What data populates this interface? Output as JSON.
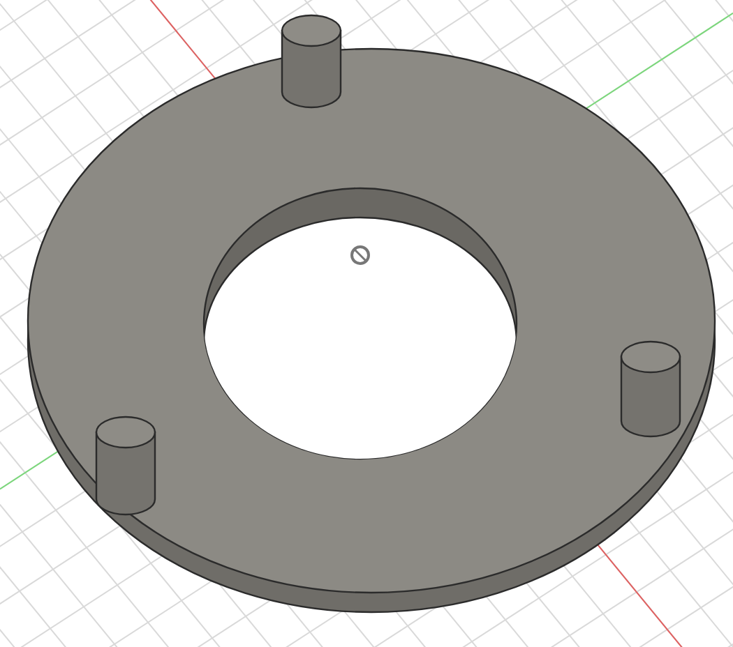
{
  "viewport": {
    "grid_visible": true,
    "axes_visible": true,
    "origin_marker": true,
    "model": {
      "kind": "ring-with-pegs",
      "pegs": [
        {
          "kind": "cylinder"
        },
        {
          "kind": "cylinder"
        },
        {
          "kind": "cylinder"
        }
      ]
    }
  }
}
